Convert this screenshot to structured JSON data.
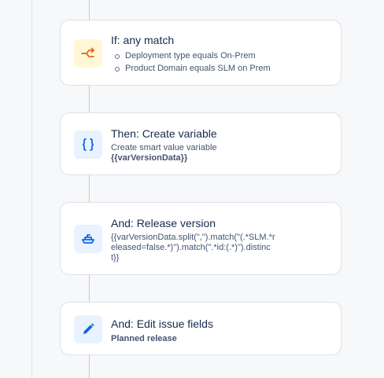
{
  "steps": [
    {
      "title": "If: any match",
      "icon": "branch-icon",
      "conditions": [
        "Deployment type equals On-Prem",
        "Product Domain equals SLM on Prem"
      ]
    },
    {
      "title": "Then: Create variable",
      "icon": "curly-braces-icon",
      "line1": "Create smart value variable",
      "line2": "{{varVersionData}}"
    },
    {
      "title": "And: Release version",
      "icon": "ship-icon",
      "code": "{{varVersionData.split(\",\").match(\"(.*SLM.*released=false.*)\").match(\".*id:(.*)\").distinct}}"
    },
    {
      "title": "And: Edit issue fields",
      "icon": "pencil-icon",
      "line1": "Planned release"
    }
  ],
  "colors": {
    "condition_icon": "#e56910",
    "action_icon": "#0c66e4",
    "condition_bg": "#fff7d6",
    "action_bg": "#e9f2ff"
  }
}
